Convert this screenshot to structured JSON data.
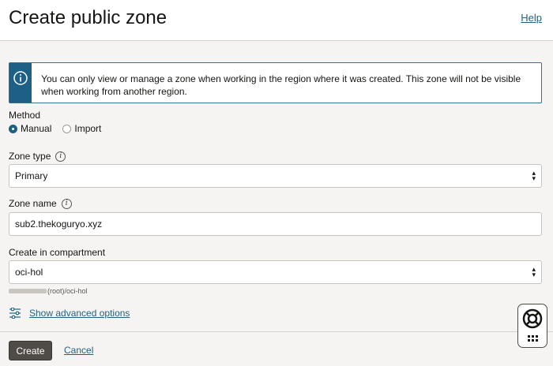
{
  "header": {
    "title": "Create public zone",
    "help_label": "Help"
  },
  "banner": {
    "icon": "info-icon",
    "message": "You can only view or manage a zone when working in the region where it was created. This zone will not be visible when working from another region."
  },
  "method": {
    "label": "Method",
    "options": [
      {
        "label": "Manual",
        "selected": true
      },
      {
        "label": "Import",
        "selected": false
      }
    ]
  },
  "zone_type": {
    "label": "Zone type",
    "value": "Primary"
  },
  "zone_name": {
    "label": "Zone name",
    "value": "sub2.thekoguryo.xyz"
  },
  "compartment": {
    "label": "Create in compartment",
    "value": "oci-hol",
    "path": "(root)/oci-hol"
  },
  "advanced": {
    "label": "Show advanced options",
    "icon": "sliders-icon"
  },
  "footer": {
    "create_label": "Create",
    "cancel_label": "Cancel"
  },
  "help_widget": {
    "icon": "life-ring-icon",
    "grid_icon": "apps-grid-icon"
  },
  "colors": {
    "accent": "#1e5f86",
    "link": "#23627e",
    "primary_button": "#4f4b47"
  }
}
